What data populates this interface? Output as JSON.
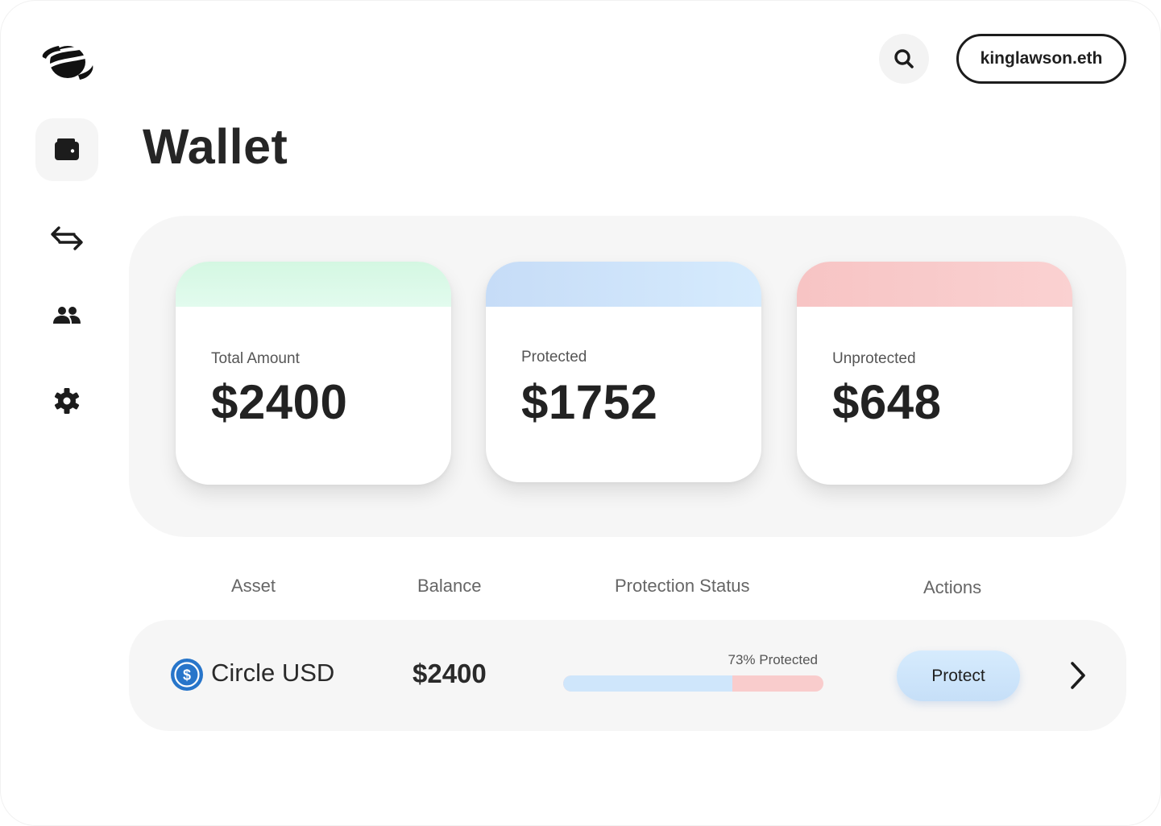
{
  "header": {
    "account_label": "kinglawson.eth"
  },
  "sidebar": {
    "items": [
      {
        "name": "wallet",
        "icon": "wallet-icon",
        "active": true
      },
      {
        "name": "transfer",
        "icon": "swap-arrows-icon",
        "active": false
      },
      {
        "name": "contacts",
        "icon": "people-icon",
        "active": false
      },
      {
        "name": "settings",
        "icon": "gear-icon",
        "active": false
      }
    ]
  },
  "page": {
    "title": "Wallet"
  },
  "summary": {
    "cards": [
      {
        "label": "Total Amount",
        "value": "$2400",
        "accent": "#d8f8e6"
      },
      {
        "label": "Protected",
        "value": "$1752",
        "accent": "#cfe5fb"
      },
      {
        "label": "Unprotected",
        "value": "$648",
        "accent": "#f9cccc"
      }
    ]
  },
  "table": {
    "headers": {
      "asset": "Asset",
      "balance": "Balance",
      "protection_status": "Protection Status",
      "actions": "Actions"
    },
    "rows": [
      {
        "asset": "Circle USD",
        "asset_icon": "usdc-coin-icon",
        "balance": "$2400",
        "protection_label": "73% Protected",
        "protection_fraction": 0.65,
        "action_label": "Protect"
      }
    ]
  },
  "colors": {
    "protected": "#cfe6fb",
    "unprotected": "#f9cccc",
    "coin": "#2775ca"
  }
}
